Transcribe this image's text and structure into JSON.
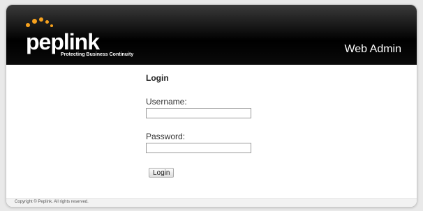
{
  "header": {
    "logo_text": "peplink",
    "tagline": "Protecting Business Continuity",
    "web_admin": "Web Admin"
  },
  "login": {
    "title": "Login",
    "username_label": "Username:",
    "username_value": "",
    "password_label": "Password:",
    "password_value": "",
    "button_label": "Login"
  },
  "footer": {
    "copyright": "Copyright © Peplink. All rights reserved."
  },
  "colors": {
    "header_bg": "#000000",
    "logo_dots": "#f6a11d",
    "page_bg": "#ffffff"
  }
}
